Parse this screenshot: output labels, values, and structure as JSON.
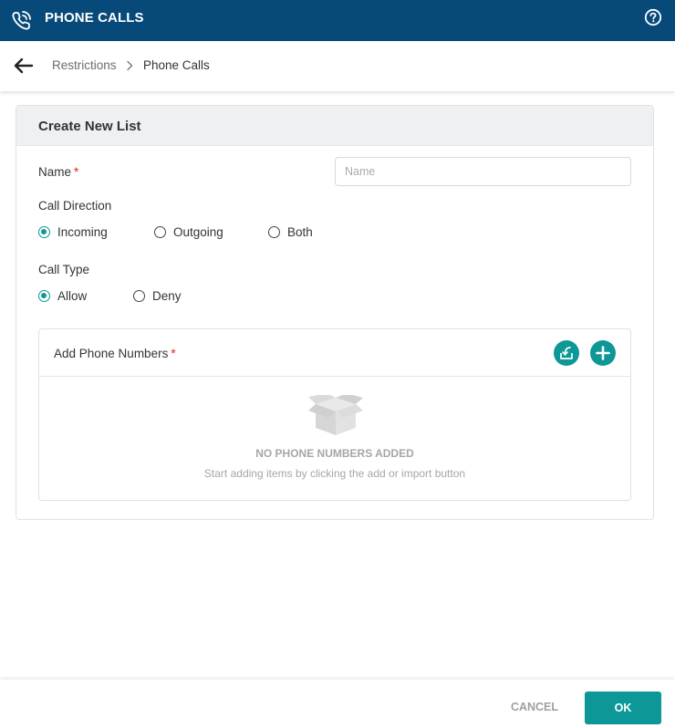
{
  "header": {
    "title": "PHONE CALLS",
    "app_icon": "phone-calls-icon",
    "help_icon": "help-circle-icon",
    "background": "#074a7a"
  },
  "breadcrumb": {
    "back_icon": "arrow-left-icon",
    "items": [
      "Restrictions",
      "Phone Calls"
    ],
    "separator_icon": "chevron-right-icon"
  },
  "form": {
    "title": "Create New List",
    "name_label": "Name",
    "name_required": "*",
    "name_placeholder": "Name",
    "name_value": "",
    "call_direction_label": "Call Direction",
    "call_direction_options": [
      "Incoming",
      "Outgoing",
      "Both"
    ],
    "call_direction_selected": "Incoming",
    "call_type_label": "Call Type",
    "call_type_options": [
      "Allow",
      "Deny"
    ],
    "call_type_selected": "Allow",
    "phone_numbers": {
      "label": "Add Phone Numbers",
      "required": "*",
      "import_icon": "import-icon",
      "add_icon": "plus-icon",
      "empty_icon": "empty-box-icon",
      "empty_title": "NO PHONE NUMBERS ADDED",
      "empty_subtitle": "Start adding items by clicking the add or import button"
    }
  },
  "footer": {
    "cancel_label": "CANCEL",
    "ok_label": "OK"
  },
  "colors": {
    "accent": "#0d9797",
    "required": "#dd2222"
  }
}
